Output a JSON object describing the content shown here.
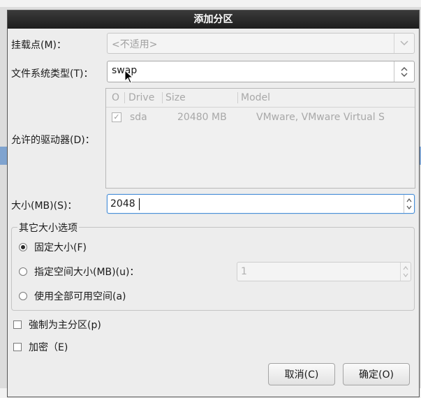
{
  "dialog": {
    "title": "添加分区",
    "mount_point": {
      "label": "挂载点(M)：",
      "value": "<不适用>"
    },
    "fs_type": {
      "label": "文件系统类型(T)：",
      "value": "swap"
    },
    "drives": {
      "label": "允许的驱动器(D)：",
      "columns": [
        "O",
        "Drive",
        "Size",
        "Model"
      ],
      "rows": [
        {
          "checked": true,
          "drive": "sda",
          "size": "20480 MB",
          "model": "VMware, VMware Virtual S"
        }
      ]
    },
    "size": {
      "label": "大小(MB)(S)：",
      "value": "2048"
    },
    "other_size_options": {
      "title": "其它大小选项",
      "fixed": "固定大小(F)",
      "fill_to": "指定空间大小(MB)(u)：",
      "fill_to_value": "1",
      "fill_all": "使用全部可用空间(a)",
      "selected": "fixed"
    },
    "force_primary": "強制为主分区(p)",
    "encrypt": "加密（E)",
    "cancel_label": "取消(C)",
    "ok_label": "确定(O)"
  },
  "icons": {
    "combo_arrow": "chevron-down-icon",
    "combo_updown": "updown-icon",
    "check": "checkmark-icon",
    "spin": "spin-arrows-icon",
    "cursor": "mouse-pointer-icon"
  }
}
